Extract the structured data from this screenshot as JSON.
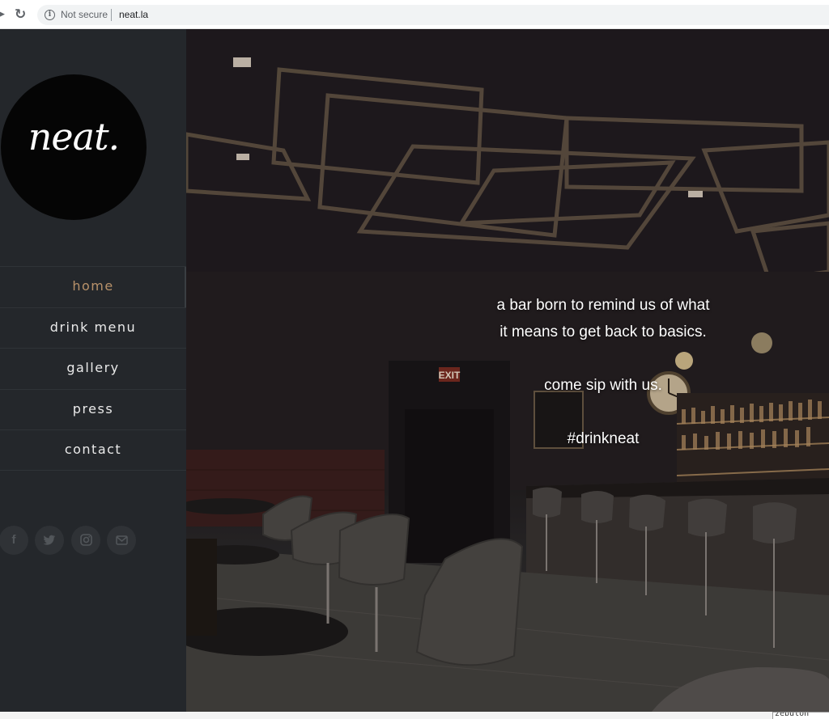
{
  "browser": {
    "security_label": "Not secure",
    "url": "neat.la"
  },
  "sidebar": {
    "logo_text": "neat.",
    "nav": [
      {
        "label": "home",
        "active": true
      },
      {
        "label": "drink menu",
        "active": false
      },
      {
        "label": "gallery",
        "active": false
      },
      {
        "label": "press",
        "active": false
      },
      {
        "label": "contact",
        "active": false
      }
    ],
    "social_icons": [
      "facebook-icon",
      "twitter-icon",
      "instagram-icon",
      "mail-icon"
    ]
  },
  "hero": {
    "line1": "a bar born to remind us of what",
    "line2": "it means to get back to basics.",
    "line3": "come sip with us.",
    "line4": "#drinkneat"
  },
  "status_bar": {
    "text": "zebulon"
  },
  "colors": {
    "sidebar_bg": "#24272b",
    "active_nav": "#b8926a",
    "logo_bg": "#050505"
  }
}
